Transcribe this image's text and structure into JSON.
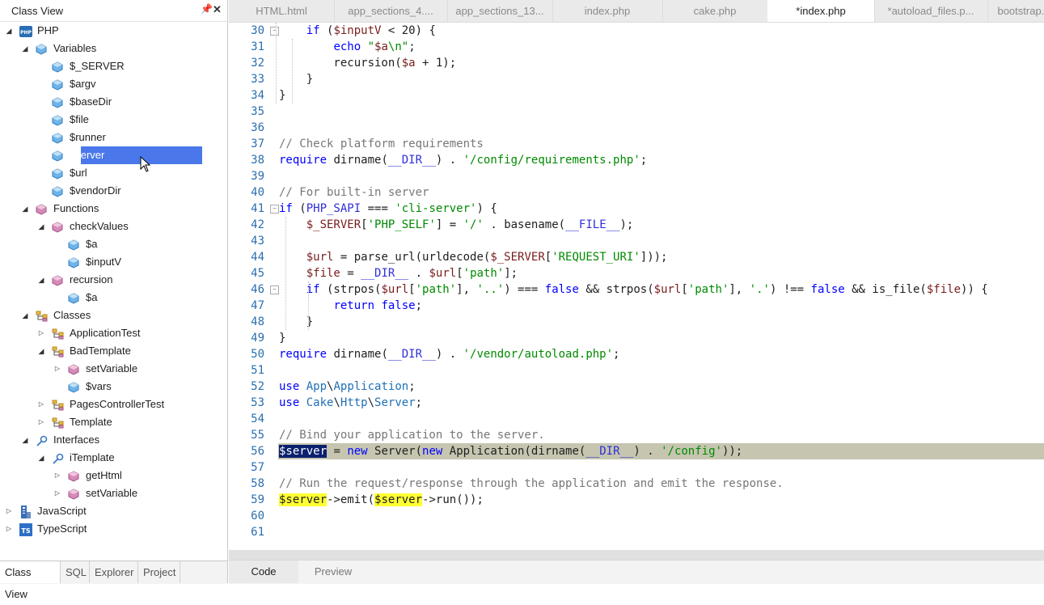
{
  "class_view": {
    "title": "Class View",
    "tree": [
      {
        "label": "PHP",
        "depth": 0,
        "arrow": "open",
        "icon": "php-icon"
      },
      {
        "label": "Variables",
        "depth": 1,
        "arrow": "open",
        "icon": "variable-icon"
      },
      {
        "label": "$_SERVER",
        "depth": 2,
        "arrow": "none",
        "icon": "variable-icon"
      },
      {
        "label": "$argv",
        "depth": 2,
        "arrow": "none",
        "icon": "variable-icon"
      },
      {
        "label": "$baseDir",
        "depth": 2,
        "arrow": "none",
        "icon": "variable-icon"
      },
      {
        "label": "$file",
        "depth": 2,
        "arrow": "none",
        "icon": "variable-icon"
      },
      {
        "label": "$runner",
        "depth": 2,
        "arrow": "none",
        "icon": "variable-icon"
      },
      {
        "label": "$server",
        "depth": 2,
        "arrow": "none",
        "icon": "variable-icon",
        "selected": true
      },
      {
        "label": "$url",
        "depth": 2,
        "arrow": "none",
        "icon": "variable-icon"
      },
      {
        "label": "$vendorDir",
        "depth": 2,
        "arrow": "none",
        "icon": "variable-icon"
      },
      {
        "label": "Functions",
        "depth": 1,
        "arrow": "open",
        "icon": "function-icon"
      },
      {
        "label": "checkValues",
        "depth": 2,
        "arrow": "open",
        "icon": "function-icon"
      },
      {
        "label": "$a",
        "depth": 3,
        "arrow": "none",
        "icon": "variable-icon"
      },
      {
        "label": "$inputV",
        "depth": 3,
        "arrow": "none",
        "icon": "variable-icon"
      },
      {
        "label": "recursion",
        "depth": 2,
        "arrow": "open",
        "icon": "function-icon"
      },
      {
        "label": "$a",
        "depth": 3,
        "arrow": "none",
        "icon": "variable-icon"
      },
      {
        "label": "Classes",
        "depth": 1,
        "arrow": "open",
        "icon": "class-icon"
      },
      {
        "label": "ApplicationTest",
        "depth": 2,
        "arrow": "closed",
        "icon": "class-icon"
      },
      {
        "label": "BadTemplate",
        "depth": 2,
        "arrow": "open",
        "icon": "class-icon"
      },
      {
        "label": "setVariable",
        "depth": 3,
        "arrow": "closed",
        "icon": "function-icon"
      },
      {
        "label": "$vars",
        "depth": 3,
        "arrow": "none",
        "icon": "variable-icon"
      },
      {
        "label": "PagesControllerTest",
        "depth": 2,
        "arrow": "closed",
        "icon": "class-icon"
      },
      {
        "label": "Template",
        "depth": 2,
        "arrow": "closed",
        "icon": "class-icon"
      },
      {
        "label": "Interfaces",
        "depth": 1,
        "arrow": "open",
        "icon": "interface-icon"
      },
      {
        "label": "iTemplate",
        "depth": 2,
        "arrow": "open",
        "icon": "interface-icon"
      },
      {
        "label": "getHtml",
        "depth": 3,
        "arrow": "closed",
        "icon": "function-icon"
      },
      {
        "label": "setVariable",
        "depth": 3,
        "arrow": "closed",
        "icon": "function-icon"
      },
      {
        "label": "JavaScript",
        "depth": 0,
        "arrow": "closed",
        "icon": "javascript-icon"
      },
      {
        "label": "TypeScript",
        "depth": 0,
        "arrow": "closed",
        "icon": "typescript-icon"
      }
    ],
    "bottom_tabs": [
      "Class View",
      "SQL",
      "Explorer",
      "Project"
    ],
    "pin_glyph": "📌",
    "close_glyph": "✕"
  },
  "editor": {
    "tabs": [
      {
        "label": "HTML.html"
      },
      {
        "label": "app_sections_4...."
      },
      {
        "label": "app_sections_13..."
      },
      {
        "label": "index.php"
      },
      {
        "label": "cake.php"
      },
      {
        "label": "*index.php",
        "active": true
      },
      {
        "label": "*autoload_files.p..."
      },
      {
        "label": "bootstrap.p"
      }
    ],
    "first_line": 30,
    "line_count": 32,
    "bottom_tabs": [
      "Code",
      "Preview"
    ],
    "colors": {
      "keyword": "#0000ff",
      "variable": "#7a1d1d",
      "string": "#008a00",
      "comment": "#777777",
      "highlight_row": "#c5c5b0",
      "search_hit": "#ffff33",
      "selection": "#0a1f6e"
    }
  },
  "code_lines": [
    [
      [
        "    ",
        ""
      ],
      [
        "if",
        "kw"
      ],
      [
        " (",
        ""
      ],
      [
        "$inputV",
        "var"
      ],
      [
        " < 20) {",
        ""
      ]
    ],
    [
      [
        "        ",
        ""
      ],
      [
        "echo",
        "kw"
      ],
      [
        " ",
        ""
      ],
      [
        "\"",
        "str"
      ],
      [
        "$a",
        "var"
      ],
      [
        "\\n\"",
        "str"
      ],
      [
        ";",
        ""
      ]
    ],
    [
      [
        "        recursion(",
        ""
      ],
      [
        "$a",
        "var"
      ],
      [
        " + 1);",
        ""
      ]
    ],
    [
      [
        "    }",
        ""
      ]
    ],
    [
      [
        "}",
        ""
      ]
    ],
    [],
    [],
    [
      [
        "// Check platform requirements",
        "com"
      ]
    ],
    [
      [
        "require",
        "kw"
      ],
      [
        " dirname(",
        ""
      ],
      [
        "__DIR__",
        "con"
      ],
      [
        ") . ",
        ""
      ],
      [
        "'/config/requirements.php'",
        "str"
      ],
      [
        ";",
        ""
      ]
    ],
    [],
    [
      [
        "// For built-in server",
        "com"
      ]
    ],
    [
      [
        "if",
        "kw"
      ],
      [
        " (",
        ""
      ],
      [
        "PHP_SAPI",
        "con"
      ],
      [
        " === ",
        ""
      ],
      [
        "'cli-server'",
        "str"
      ],
      [
        ") {",
        ""
      ]
    ],
    [
      [
        "    ",
        ""
      ],
      [
        "$_SERVER",
        "var"
      ],
      [
        "[",
        ""
      ],
      [
        "'PHP_SELF'",
        "str"
      ],
      [
        "] = ",
        ""
      ],
      [
        "'/'",
        "str"
      ],
      [
        " . basename(",
        ""
      ],
      [
        "__FILE__",
        "con"
      ],
      [
        ");",
        ""
      ]
    ],
    [],
    [
      [
        "    ",
        ""
      ],
      [
        "$url",
        "var"
      ],
      [
        " = parse_url(urldecode(",
        ""
      ],
      [
        "$_SERVER",
        "var"
      ],
      [
        "[",
        ""
      ],
      [
        "'REQUEST_URI'",
        "str"
      ],
      [
        "]));",
        ""
      ]
    ],
    [
      [
        "    ",
        ""
      ],
      [
        "$file",
        "var"
      ],
      [
        " = ",
        ""
      ],
      [
        "__DIR__",
        "con"
      ],
      [
        " . ",
        ""
      ],
      [
        "$url",
        "var"
      ],
      [
        "[",
        ""
      ],
      [
        "'path'",
        "str"
      ],
      [
        "];",
        ""
      ]
    ],
    [
      [
        "    ",
        ""
      ],
      [
        "if",
        "kw"
      ],
      [
        " (strpos(",
        ""
      ],
      [
        "$url",
        "var"
      ],
      [
        "[",
        ""
      ],
      [
        "'path'",
        "str"
      ],
      [
        "], ",
        ""
      ],
      [
        "'..'",
        "str"
      ],
      [
        ") === ",
        ""
      ],
      [
        "false",
        "kw"
      ],
      [
        " && strpos(",
        ""
      ],
      [
        "$url",
        "var"
      ],
      [
        "[",
        ""
      ],
      [
        "'path'",
        "str"
      ],
      [
        "], ",
        ""
      ],
      [
        "'.'",
        "str"
      ],
      [
        ") !== ",
        ""
      ],
      [
        "false",
        "kw"
      ],
      [
        " && is_file(",
        ""
      ],
      [
        "$file",
        "var"
      ],
      [
        ")) {",
        ""
      ]
    ],
    [
      [
        "        ",
        ""
      ],
      [
        "return",
        "kw"
      ],
      [
        " ",
        ""
      ],
      [
        "false",
        "kw"
      ],
      [
        ";",
        ""
      ]
    ],
    [
      [
        "    }",
        ""
      ]
    ],
    [
      [
        "}",
        ""
      ]
    ],
    [
      [
        "require",
        "kw"
      ],
      [
        " dirname(",
        ""
      ],
      [
        "__DIR__",
        "con"
      ],
      [
        ") . ",
        ""
      ],
      [
        "'/vendor/autoload.php'",
        "str"
      ],
      [
        ";",
        ""
      ]
    ],
    [],
    [
      [
        "use",
        "kw"
      ],
      [
        " ",
        ""
      ],
      [
        "App",
        "cls"
      ],
      [
        "\\",
        ""
      ],
      [
        "Application",
        "cls"
      ],
      [
        ";",
        ""
      ]
    ],
    [
      [
        "use",
        "kw"
      ],
      [
        " ",
        ""
      ],
      [
        "Cake",
        "cls"
      ],
      [
        "\\",
        ""
      ],
      [
        "Http",
        "cls"
      ],
      [
        "\\",
        ""
      ],
      [
        "Server",
        "cls"
      ],
      [
        ";",
        ""
      ]
    ],
    [],
    [
      [
        "// Bind your application to the server.",
        "com"
      ]
    ],
    [
      [
        "$server",
        "sv"
      ],
      [
        " = ",
        ""
      ],
      [
        "new",
        "kw"
      ],
      [
        " Server(",
        ""
      ],
      [
        "new",
        "kw"
      ],
      [
        " Application(dirname(",
        ""
      ],
      [
        "__DIR__",
        "con"
      ],
      [
        ") . ",
        ""
      ],
      [
        "'/config'",
        "str"
      ],
      [
        "));",
        ""
      ]
    ],
    [],
    [
      [
        "// Run the request/response through the application and emit the response.",
        "com"
      ]
    ],
    [
      [
        "$server",
        "hv"
      ],
      [
        "->emit(",
        ""
      ],
      [
        "$server",
        "hv"
      ],
      [
        "->run());",
        ""
      ]
    ],
    [],
    []
  ]
}
